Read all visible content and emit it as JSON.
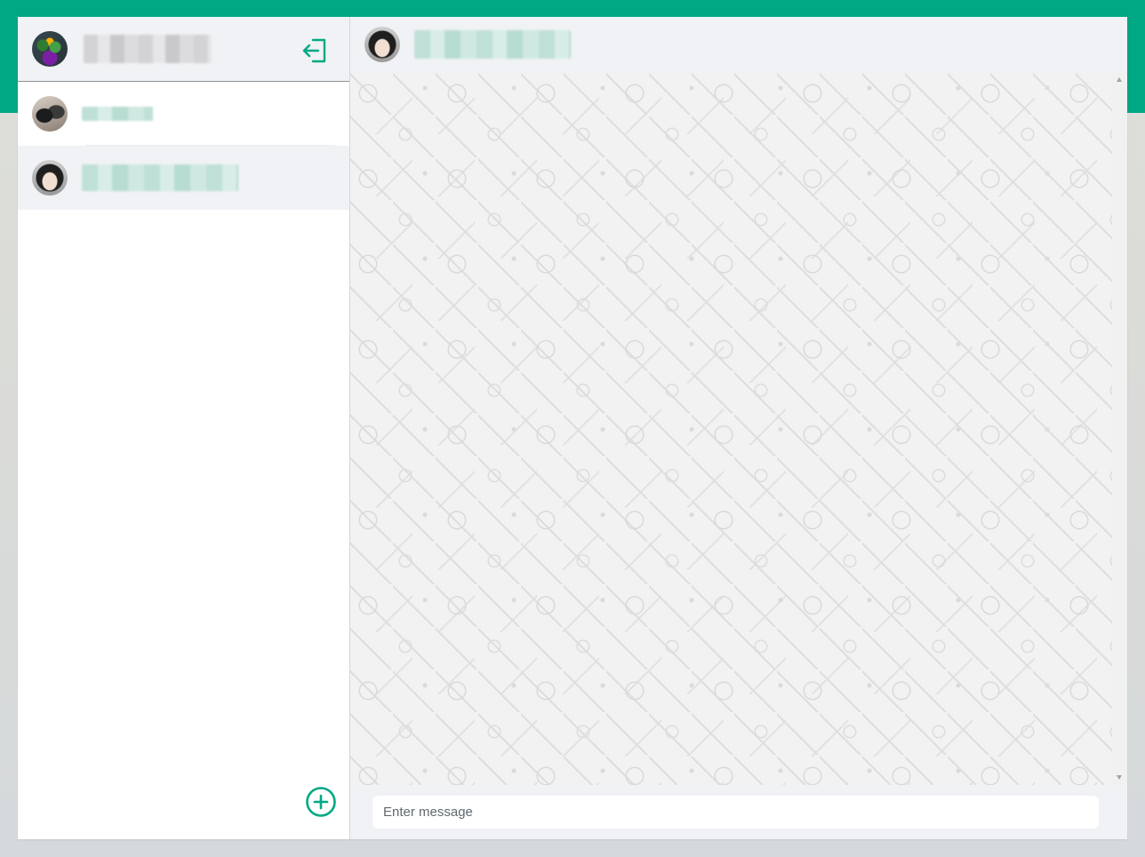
{
  "theme": {
    "accent": "#00a884",
    "panel_bg": "#f0f2f5",
    "active_row_bg": "#f0f2f5"
  },
  "sidebar": {
    "header": {
      "avatar": "user-avatar",
      "logout_icon": "logout-icon"
    },
    "chats": [
      {
        "avatar": "cat-avatar",
        "active": false
      },
      {
        "avatar": "girl-avatar",
        "active": true
      }
    ],
    "new_chat_icon": "plus-circle-icon"
  },
  "chat": {
    "header": {
      "avatar": "girl-avatar"
    },
    "composer": {
      "placeholder": "Enter message"
    }
  }
}
